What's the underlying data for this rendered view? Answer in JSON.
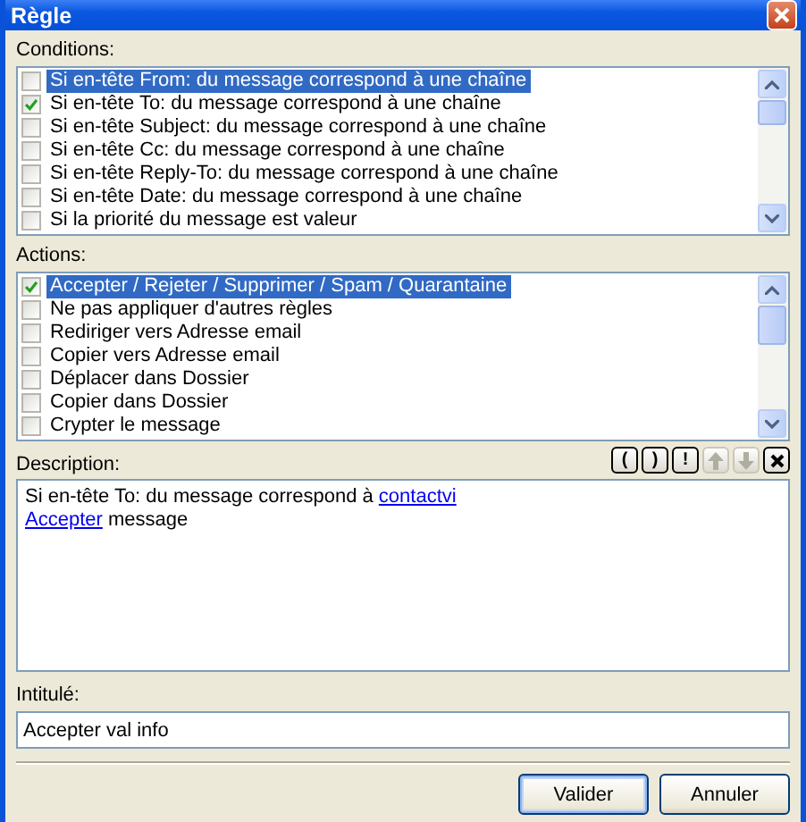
{
  "window": {
    "title": "Règle"
  },
  "conditions": {
    "label": "Conditions:",
    "items": [
      {
        "text": "Si en-tête From: du message correspond à une chaîne",
        "checked": false,
        "selected": true
      },
      {
        "text": "Si en-tête To: du message correspond à une chaîne",
        "checked": true,
        "selected": false
      },
      {
        "text": "Si en-tête Subject: du message correspond à une chaîne",
        "checked": false,
        "selected": false
      },
      {
        "text": "Si en-tête Cc: du message correspond à une chaîne",
        "checked": false,
        "selected": false
      },
      {
        "text": "Si en-tête Reply-To: du message correspond à une chaîne",
        "checked": false,
        "selected": false
      },
      {
        "text": "Si en-tête Date: du message correspond à une chaîne",
        "checked": false,
        "selected": false
      },
      {
        "text": "Si la priorité du message est valeur",
        "checked": false,
        "selected": false
      }
    ]
  },
  "actions": {
    "label": "Actions:",
    "items": [
      {
        "text": "Accepter / Rejeter / Supprimer / Spam / Quarantaine",
        "checked": true,
        "selected": true
      },
      {
        "text": "Ne pas appliquer d'autres règles",
        "checked": false,
        "selected": false
      },
      {
        "text": "Rediriger vers Adresse email",
        "checked": false,
        "selected": false
      },
      {
        "text": "Copier vers Adresse email",
        "checked": false,
        "selected": false
      },
      {
        "text": "Déplacer dans Dossier",
        "checked": false,
        "selected": false
      },
      {
        "text": "Copier dans Dossier",
        "checked": false,
        "selected": false
      },
      {
        "text": "Crypter le message",
        "checked": false,
        "selected": false
      }
    ]
  },
  "description": {
    "label": "Description:",
    "tools": [
      {
        "kind": "text",
        "label": "(",
        "disabled": false
      },
      {
        "kind": "text",
        "label": ")",
        "disabled": false
      },
      {
        "kind": "text",
        "label": "!",
        "disabled": false
      },
      {
        "kind": "up",
        "disabled": true
      },
      {
        "kind": "down",
        "disabled": true
      },
      {
        "kind": "close",
        "disabled": false
      }
    ],
    "lines": [
      [
        {
          "text": "Si en-tête To: du message correspond à ",
          "link": false
        },
        {
          "text": "contactvi",
          "link": true
        }
      ],
      [
        {
          "text": "Accepter",
          "link": true
        },
        {
          "text": " message",
          "link": false
        }
      ]
    ]
  },
  "name_field": {
    "label": "Intitulé:",
    "value": "Accepter val info"
  },
  "buttons": [
    {
      "label": "Valider",
      "default": true
    },
    {
      "label": "Annuler",
      "default": false
    }
  ]
}
